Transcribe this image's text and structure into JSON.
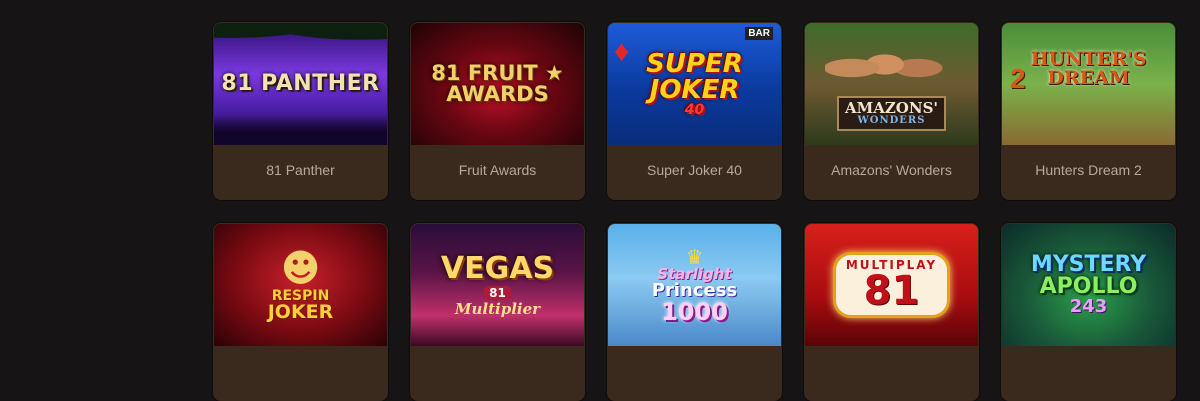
{
  "games": [
    {
      "title": "81 Panther",
      "art": {
        "line1": "81 PANTHER"
      }
    },
    {
      "title": "Fruit Awards",
      "art": {
        "line1": "81 FRUIT",
        "line2": "AWARDS",
        "star": "★"
      }
    },
    {
      "title": "Super Joker 40",
      "art": {
        "line1": "SUPER",
        "line2": "JOKER",
        "line3": "40",
        "badge": "BAR"
      }
    },
    {
      "title": "Amazons' Wonders",
      "art": {
        "line1": "AMAZONS'",
        "line2": "WONDERS"
      }
    },
    {
      "title": "Hunters Dream 2",
      "art": {
        "line1": "HUNTER'S",
        "line2": "DREAM",
        "line3": "2"
      }
    },
    {
      "title": "",
      "art": {
        "line1": "RESPIN",
        "line2": "JOKER"
      }
    },
    {
      "title": "",
      "art": {
        "line1": "VEGAS",
        "line2": "81",
        "line3": "Multiplier"
      }
    },
    {
      "title": "",
      "art": {
        "line1": "Starlight",
        "line2": "Princess",
        "line3": "1000"
      }
    },
    {
      "title": "",
      "art": {
        "line1": "MULTIPLAY",
        "line2": "81"
      }
    },
    {
      "title": "",
      "art": {
        "line1": "MYSTERY",
        "line2": "APOLLO",
        "line3": "243"
      }
    }
  ],
  "colors": {
    "page_background": "#161414",
    "card_background": "#3a2a1e",
    "card_title_text": "#b5a99c"
  }
}
